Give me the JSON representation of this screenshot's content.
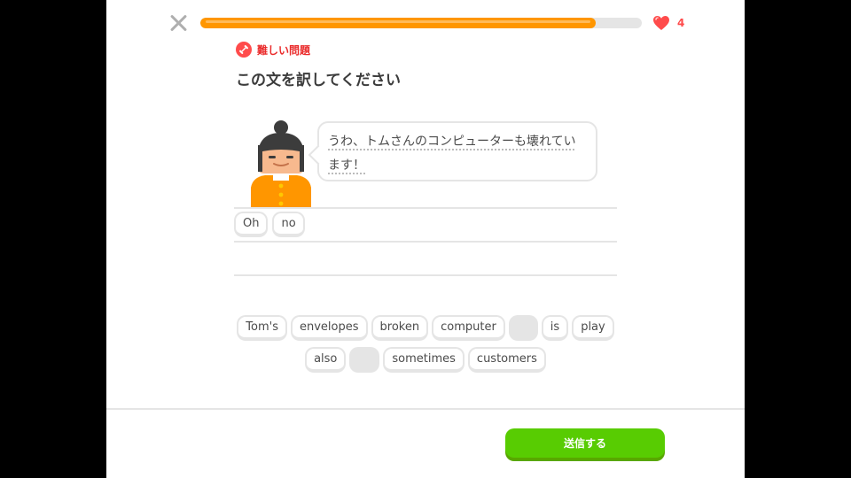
{
  "progress": {
    "value_percent": 89.5,
    "color": "#ff9600"
  },
  "hearts": {
    "count": "4",
    "color": "#ff4b4b"
  },
  "badge": {
    "label": "難しい問題",
    "icon": "dumbbell-icon"
  },
  "page_title": "この文を訳してください",
  "prompt": {
    "text": "うわ、トムさんのコンピューターも壊れています！"
  },
  "answer": {
    "words": [
      "Oh",
      "no"
    ]
  },
  "word_bank": {
    "row1": [
      {
        "label": "Tom's",
        "used": false
      },
      {
        "label": "envelopes",
        "used": false
      },
      {
        "label": "broken",
        "used": false
      },
      {
        "label": "computer",
        "used": false
      },
      {
        "label": "",
        "used": true
      },
      {
        "label": "is",
        "used": false
      },
      {
        "label": "play",
        "used": false
      }
    ],
    "row2": [
      {
        "label": "also",
        "used": false
      },
      {
        "label": "",
        "used": true
      },
      {
        "label": "sometimes",
        "used": false
      },
      {
        "label": "customers",
        "used": false
      }
    ]
  },
  "footer": {
    "submit_label": "送信する",
    "submit_color": "#58cc02"
  }
}
